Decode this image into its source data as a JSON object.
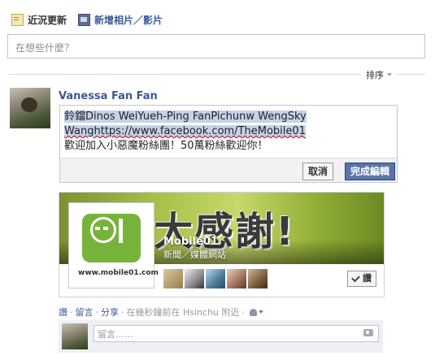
{
  "tabs": [
    {
      "label": "近況更新",
      "icon": "status-icon"
    },
    {
      "label": "新增相片／影片",
      "icon": "photo-video-icon"
    }
  ],
  "composer": {
    "placeholder": "在想些什麼？"
  },
  "sort": {
    "label": "排序"
  },
  "post": {
    "author": "Vanessa Fan Fan",
    "editor": {
      "line1": "鈴鐺Dinos WeiYueh-Ping FanPichunw WengSky",
      "line2": "Wanghttps://www.facebook.com/TheMobile01",
      "line3": "歡迎加入小惡魔粉絲團！50萬粉絲歡迎你！"
    },
    "cancel_label": "取消",
    "done_label": "完成編輯"
  },
  "shared_page": {
    "cover_text": "大感謝!",
    "name": "Mobile01",
    "category": "新聞／媒體網站",
    "logo_url_text": "www.mobile01.com",
    "like_label": "讚"
  },
  "actions": {
    "like": "讚",
    "comment": "留言",
    "share": "分享",
    "meta": "在幾秒鐘前在 Hsinchu 附近"
  },
  "comment": {
    "placeholder": "留言……"
  }
}
